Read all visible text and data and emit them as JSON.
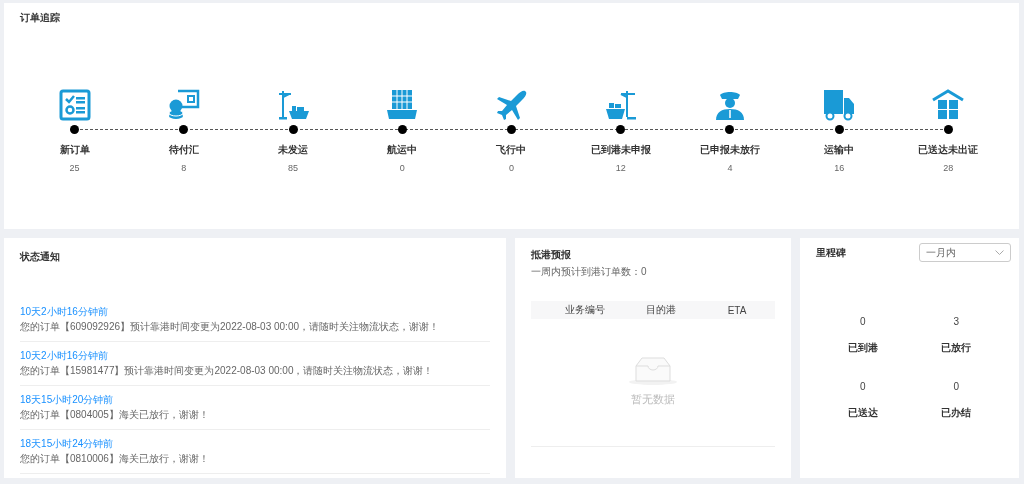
{
  "order_tracking": {
    "title": "订单追踪",
    "stages": [
      {
        "label": "新订单",
        "count": "25"
      },
      {
        "label": "待付汇",
        "count": "8"
      },
      {
        "label": "未发运",
        "count": "85"
      },
      {
        "label": "航运中",
        "count": "0"
      },
      {
        "label": "飞行中",
        "count": "0"
      },
      {
        "label": "已到港未申报",
        "count": "12"
      },
      {
        "label": "已申报未放行",
        "count": "4"
      },
      {
        "label": "运输中",
        "count": "16"
      },
      {
        "label": "已送达未出证",
        "count": "28"
      }
    ]
  },
  "notifications": {
    "title": "状态通知",
    "items": [
      {
        "time": "10天2小时16分钟前",
        "message": "您的订单【609092926】预计靠港时间变更为2022-08-03 00:00，请随时关注物流状态，谢谢！"
      },
      {
        "time": "10天2小时16分钟前",
        "message": "您的订单【15981477】预计靠港时间变更为2022-08-03 00:00，请随时关注物流状态，谢谢！"
      },
      {
        "time": "18天15小时20分钟前",
        "message": "您的订单【0804005】海关已放行，谢谢！"
      },
      {
        "time": "18天15小时24分钟前",
        "message": "您的订单【0810006】海关已放行，谢谢！"
      }
    ]
  },
  "arrival_forecast": {
    "title": "抵港预报",
    "subtitle": "一周内预计到港订单数：0",
    "table": {
      "columns": [
        "业务编号",
        "目的港",
        "ETA"
      ],
      "empty_text": "暂无数据"
    }
  },
  "milestones": {
    "title": "里程碑",
    "period_select": {
      "value": "一月内"
    },
    "stats": [
      {
        "value": "0",
        "label": "已到港"
      },
      {
        "value": "3",
        "label": "已放行"
      },
      {
        "value": "0",
        "label": "已送达"
      },
      {
        "value": "0",
        "label": "已办结"
      }
    ]
  }
}
